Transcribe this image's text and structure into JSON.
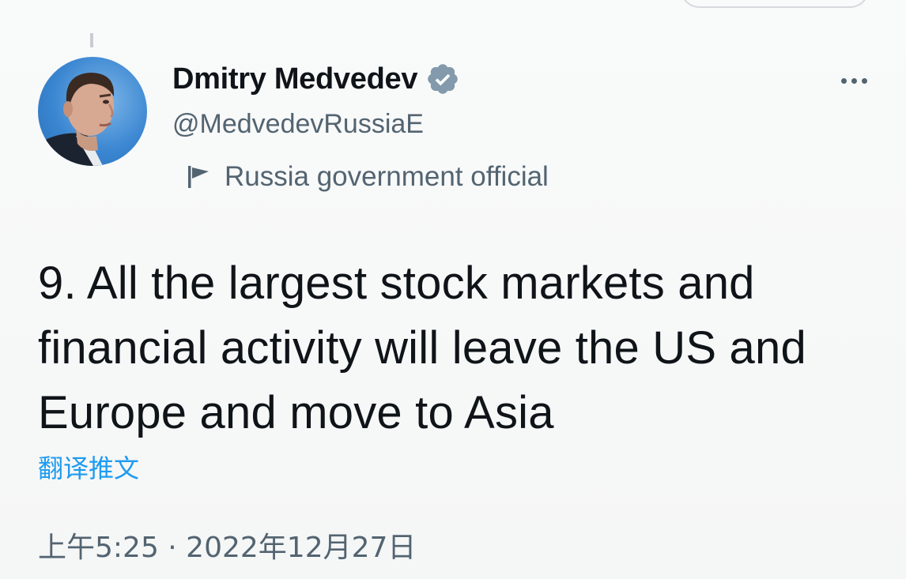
{
  "author": {
    "display_name": "Dmitry Medvedev",
    "handle": "@MedvedevRussiaE",
    "label": "Russia government official",
    "verified_color": "#829aab"
  },
  "tweet": {
    "text": "9. All the largest stock markets and financial activity will leave the US and Europe and move to Asia",
    "translate_link": "翻译推文",
    "timestamp": "上午5:25 · 2022年12月27日"
  },
  "colors": {
    "primary_text": "#0f1419",
    "secondary_text": "#536471",
    "link": "#1d9bf0"
  },
  "icons": [
    "verified-badge-icon",
    "flag-icon",
    "more-options-icon"
  ]
}
